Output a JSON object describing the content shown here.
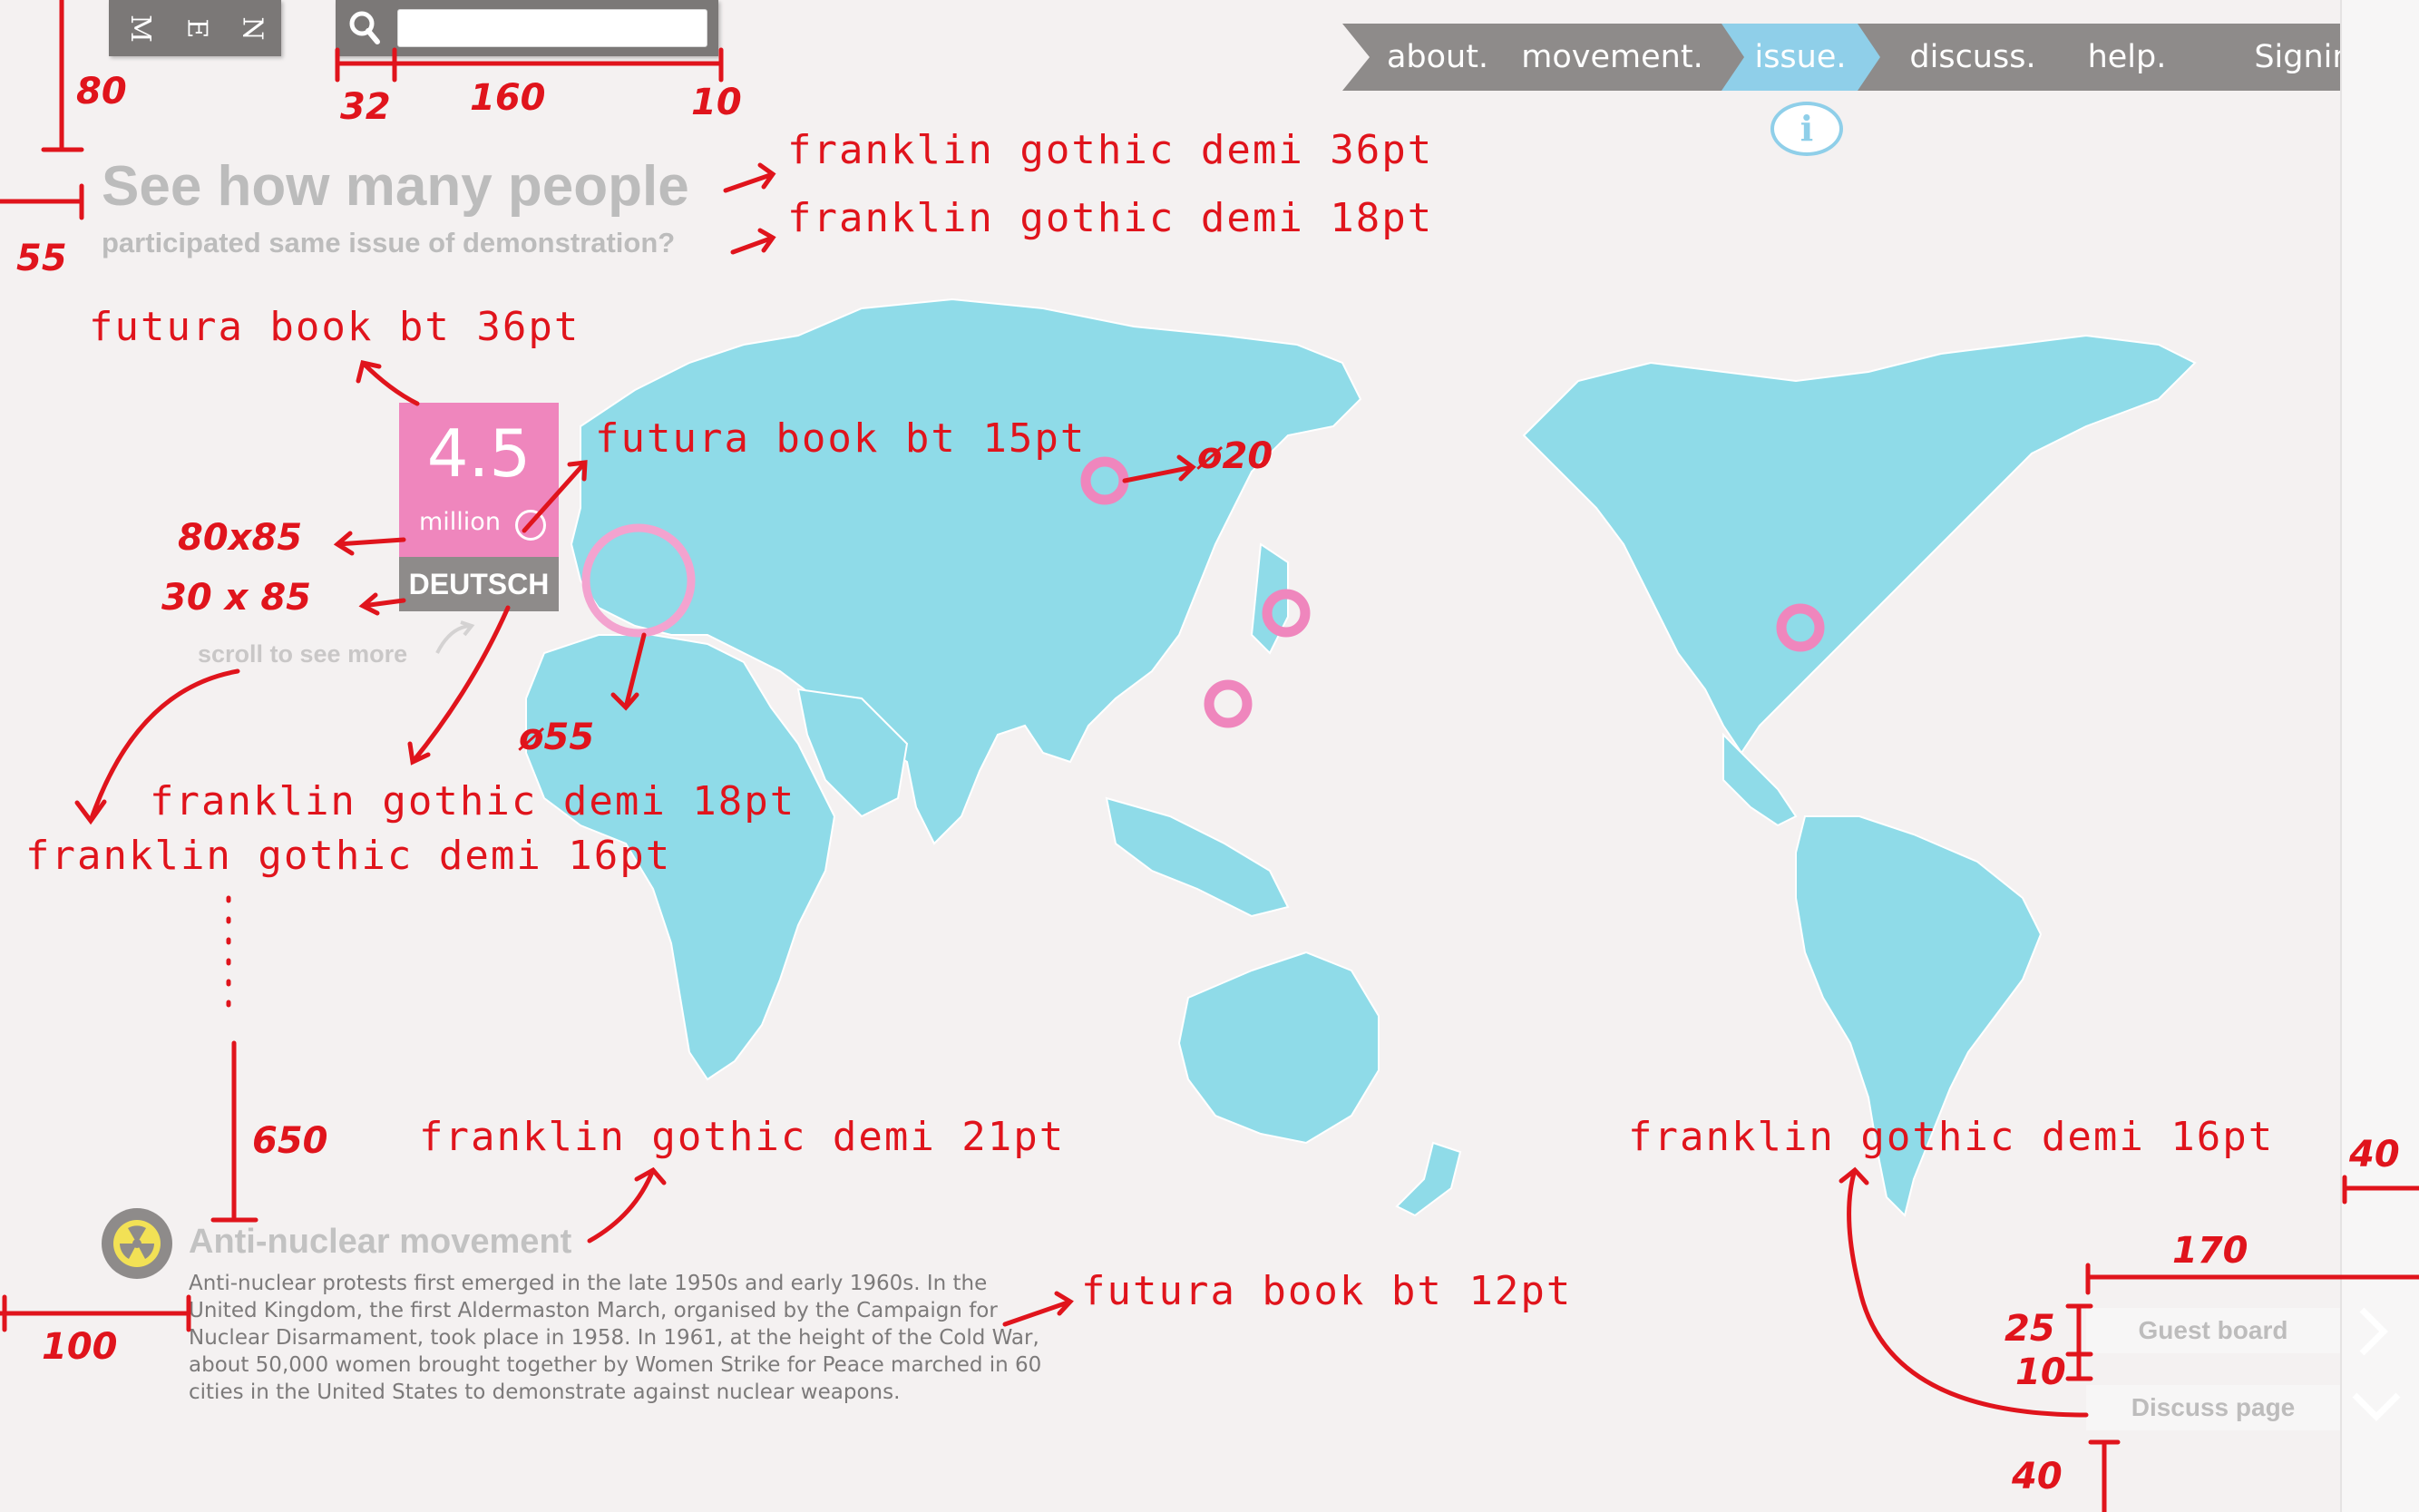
{
  "menu": {
    "letters": [
      "M",
      "E",
      "N"
    ]
  },
  "search": {
    "placeholder": ""
  },
  "nav": {
    "items": [
      "about.",
      "movement.",
      "issue.",
      "discuss.",
      "help.",
      "Signin."
    ],
    "active_index": 2,
    "active_color": "#8fcfe9"
  },
  "info_icon": "i",
  "headline": {
    "title": "See how many people",
    "subtitle": "participated same issue of demonstration?"
  },
  "stat": {
    "value": "4.5",
    "unit": "million",
    "country": "DEUTSCH",
    "accent_color": "#ef86bd"
  },
  "scroll_hint": "scroll to see more",
  "article": {
    "title": "Anti-nuclear movement",
    "body": "Anti-nuclear protests first emerged in the late 1950s and early 1960s. In the United Kingdom, the first Aldermaston March, organised by the Campaign for Nuclear Disarmament, took place in 1958. In 1961, at the height of the Cold War, about 50,000 women brought together by Women Strike for Peace marched in 60 cities in the United States to demonstrate against nuclear weapons."
  },
  "side_buttons": {
    "guest": "Guest board",
    "discuss": "Discuss page"
  },
  "map": {
    "land_color": "#8fdbe8",
    "marker_color": "#ef86bd"
  },
  "annotations": {
    "font_title": "franklin gothic demi 36pt",
    "font_subtitle": "franklin gothic demi 18pt",
    "font_stat": "futura book bt 36pt",
    "font_unit": "futura book bt 15pt",
    "marker_small": "ø20",
    "marker_large": "ø55",
    "size_stat": "80x85",
    "size_country": "30 x 85",
    "font_country": "franklin gothic demi 18pt",
    "font_scroll": "franklin gothic demi 16pt",
    "font_article_title": "franklin gothic demi 21pt",
    "font_article_body": "futura book bt 12pt",
    "font_side_buttons": "franklin gothic demi 16pt",
    "dim_top": "80",
    "dim_search_left": "32",
    "dim_search_width": "160",
    "dim_search_right": "10",
    "dim_left": "55",
    "dim_column": "650",
    "dim_article_left": "100",
    "dim_side_width": "170",
    "dim_side_right": "40",
    "dim_btn_height": "25",
    "dim_btn_gap": "10",
    "dim_bottom": "40"
  }
}
